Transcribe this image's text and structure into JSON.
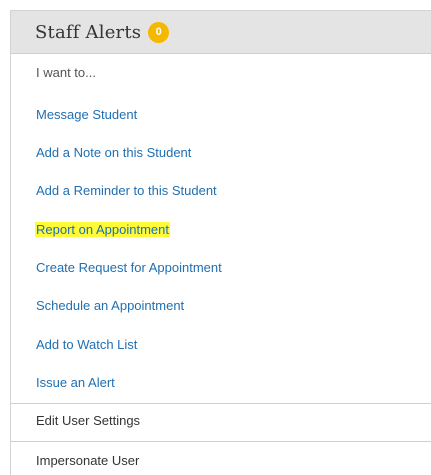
{
  "header": {
    "title": "Staff Alerts",
    "badge_count": "0"
  },
  "menu": {
    "heading": "I want to...",
    "items": [
      {
        "label": "Message Student"
      },
      {
        "label": "Add a Note on this Student"
      },
      {
        "label": "Add a Reminder to this Student"
      },
      {
        "label": "Report on Appointment",
        "highlighted": true
      },
      {
        "label": "Create Request for Appointment"
      },
      {
        "label": "Schedule an Appointment"
      },
      {
        "label": "Add to Watch List"
      },
      {
        "label": "Issue an Alert"
      }
    ]
  },
  "footer": {
    "edit_settings_label": "Edit User Settings",
    "impersonate_label": "Impersonate User"
  },
  "colors": {
    "link": "#1f6fb2",
    "highlight": "#fffb39",
    "badge": "#f5b800",
    "header_bg": "#e4e4e4"
  }
}
